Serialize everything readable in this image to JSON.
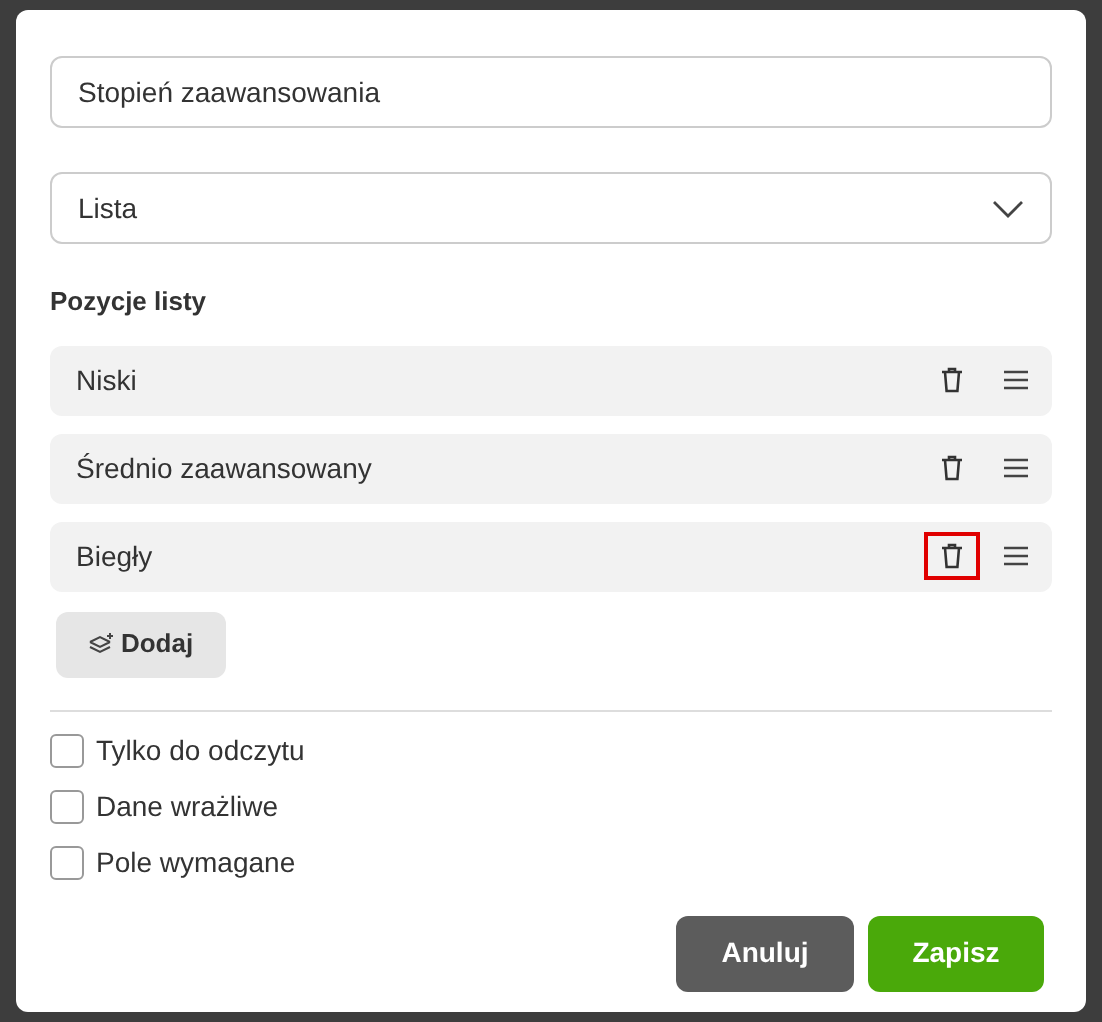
{
  "name_field": {
    "value": "Stopień zaawansowania"
  },
  "type_select": {
    "value": "Lista"
  },
  "list_heading": "Pozycje listy",
  "list_items": [
    {
      "label": "Niski",
      "highlighted": false
    },
    {
      "label": "Średnio zaawansowany",
      "highlighted": false
    },
    {
      "label": "Biegły",
      "highlighted": true
    }
  ],
  "add_button": "Dodaj",
  "options": [
    {
      "label": "Tylko do odczytu",
      "checked": false
    },
    {
      "label": "Dane wrażliwe",
      "checked": false
    },
    {
      "label": "Pole wymagane",
      "checked": false
    }
  ],
  "buttons": {
    "cancel": "Anuluj",
    "save": "Zapisz"
  }
}
